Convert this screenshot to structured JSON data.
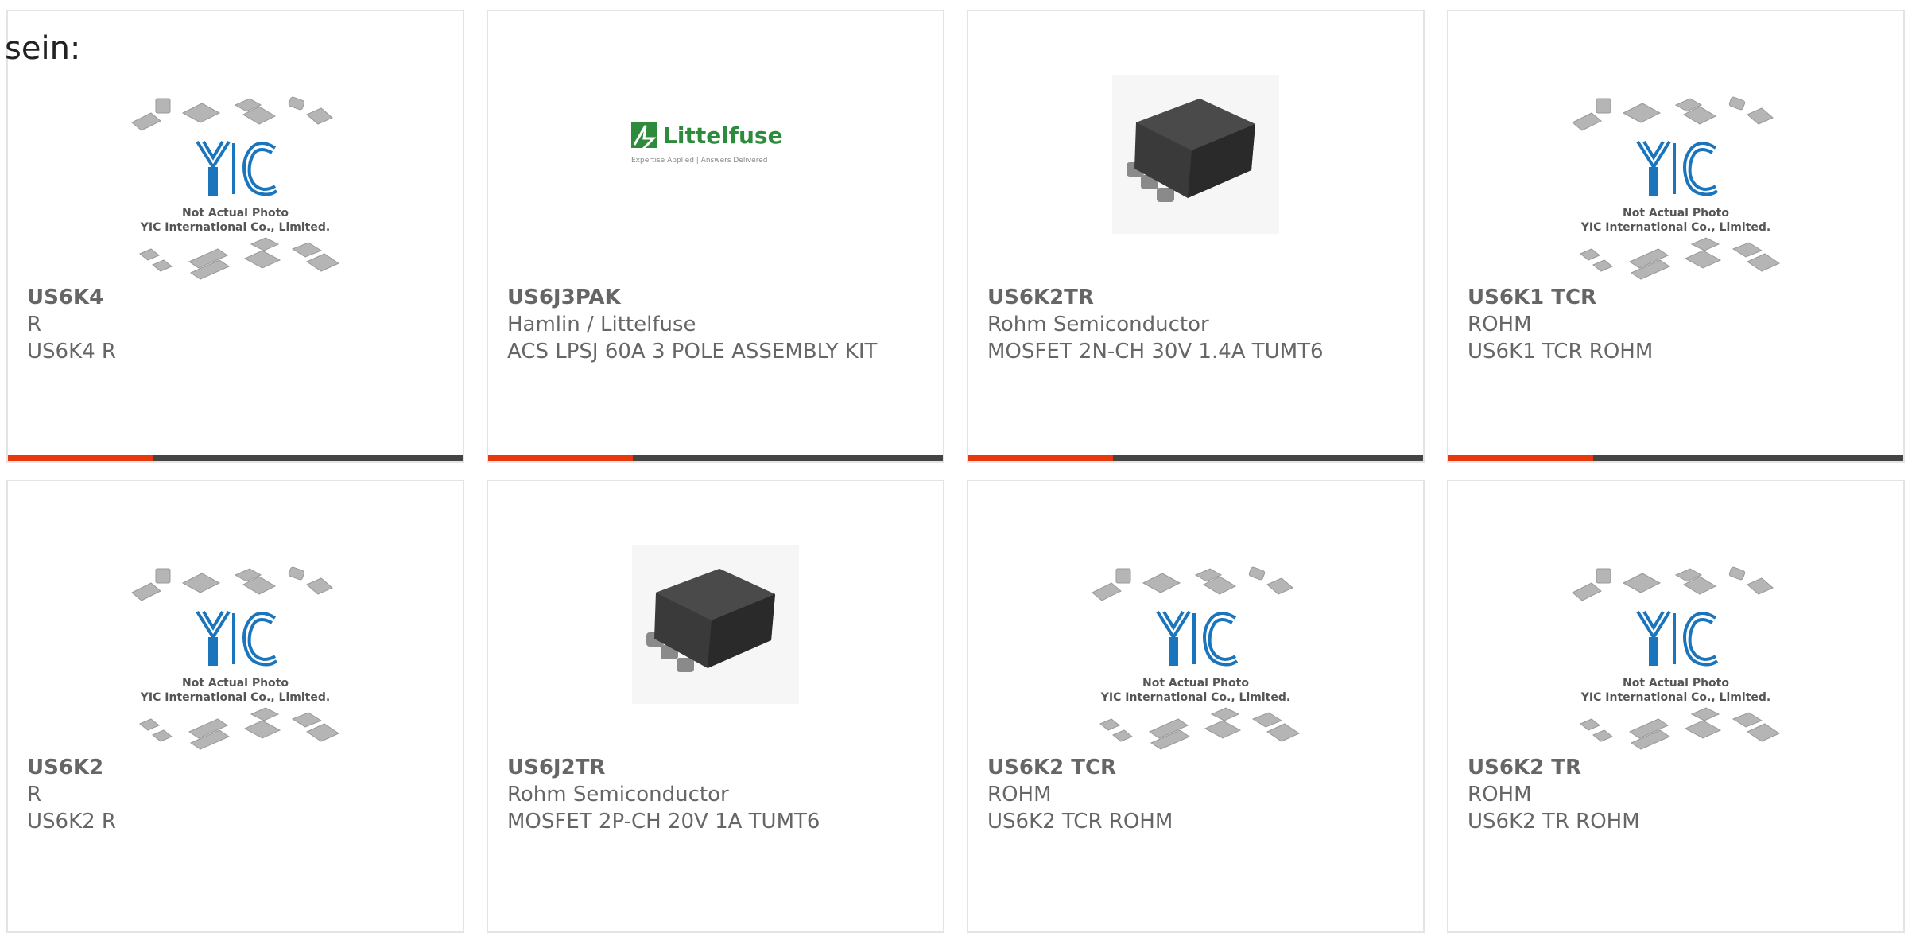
{
  "lead_text": "sein:",
  "colors": {
    "accent": "#e8380d",
    "bar": "#444444",
    "text": "#666666",
    "logo_blue": "#1b75bc",
    "littelfuse_green": "#2e8b3c"
  },
  "placeholder": {
    "line1": "Not Actual Photo",
    "line2": "YIC International Co., Limited.",
    "logo": "YIC"
  },
  "littelfuse": {
    "name": "Littelfuse",
    "tagline": "Expertise Applied | Answers Delivered"
  },
  "products": [
    {
      "part": "US6K4",
      "mfr": "R",
      "desc": "US6K4 R",
      "image": "yic-placeholder"
    },
    {
      "part": "US6J3PAK",
      "mfr": "Hamlin / Littelfuse",
      "desc": "ACS LPSJ 60A 3 POLE ASSEMBLY KIT",
      "image": "littelfuse-logo"
    },
    {
      "part": "US6K2TR",
      "mfr": "Rohm Semiconductor",
      "desc": "MOSFET 2N-CH 30V 1.4A TUMT6",
      "image": "chip-photo"
    },
    {
      "part": "US6K1 TCR",
      "mfr": "ROHM",
      "desc": "US6K1 TCR ROHM",
      "image": "yic-placeholder"
    },
    {
      "part": "US6K2",
      "mfr": "R",
      "desc": "US6K2 R",
      "image": "yic-placeholder"
    },
    {
      "part": "US6J2TR",
      "mfr": "Rohm Semiconductor",
      "desc": "MOSFET 2P-CH 20V 1A TUMT6",
      "image": "chip-photo"
    },
    {
      "part": "US6K2 TCR",
      "mfr": "ROHM",
      "desc": "US6K2 TCR ROHM",
      "image": "yic-placeholder"
    },
    {
      "part": "US6K2 TR",
      "mfr": "ROHM",
      "desc": "US6K2 TR ROHM",
      "image": "yic-placeholder"
    }
  ]
}
